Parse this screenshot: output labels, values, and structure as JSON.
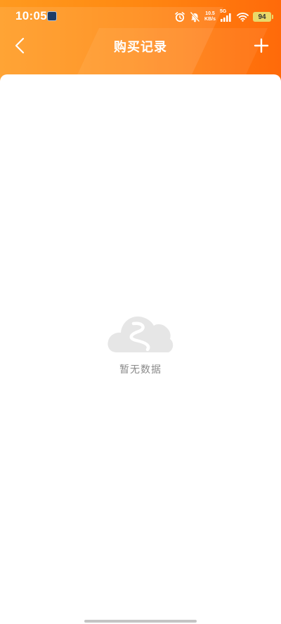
{
  "status_bar": {
    "time": "10:05",
    "network_speed_value": "10.5",
    "network_speed_unit": "KB/s",
    "signal_label": "5G",
    "battery": "94",
    "icons": [
      "app-notification-icon",
      "alarm-icon",
      "mute-icon",
      "signal-icon",
      "wifi-icon",
      "battery-icon"
    ]
  },
  "nav": {
    "title": "购买记录",
    "back_icon": "chevron-left-icon",
    "add_icon": "plus-icon"
  },
  "empty_state": {
    "icon": "empty-cloud-icon",
    "text": "暂无数据"
  },
  "colors": {
    "header_gradient_start": "#ff9a1f",
    "header_gradient_end": "#ff6a0a",
    "empty_text": "#8a8a8a",
    "empty_icon": "#e6e6e6"
  }
}
